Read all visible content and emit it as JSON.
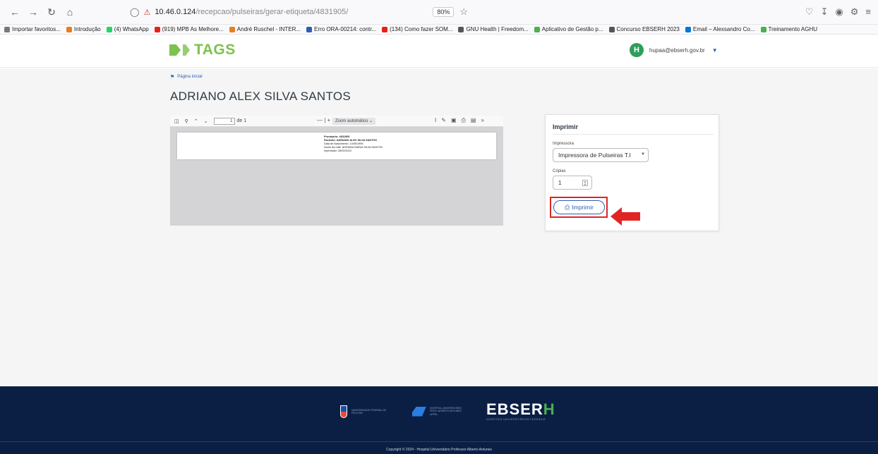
{
  "browser": {
    "url_host": "10.46.0.124",
    "url_path": "/recepcao/pulseiras/gerar-etiqueta/4831905/",
    "zoom": "80%",
    "bookmarks": [
      {
        "label": "Importar favoritos...",
        "color": "#777777"
      },
      {
        "label": "Introdução",
        "color": "#e67e22"
      },
      {
        "label": "(4) WhatsApp",
        "color": "#25d366"
      },
      {
        "label": "(919) MPB As Melhore...",
        "color": "#e62117"
      },
      {
        "label": "André Ruschel - INTER...",
        "color": "#e67e22"
      },
      {
        "label": "Erro ORA-00214: contr...",
        "color": "#2b5fb5"
      },
      {
        "label": "(134) Como fazer SOM...",
        "color": "#e62117"
      },
      {
        "label": "GNU Health | Freedom...",
        "color": "#555555"
      },
      {
        "label": "Aplicativo de Gestão p...",
        "color": "#4caf50"
      },
      {
        "label": "Concurso EBSERH 2023",
        "color": "#555555"
      },
      {
        "label": "Email – Alexsandro Co...",
        "color": "#0078d4"
      },
      {
        "label": "Treinamento AGHU",
        "color": "#4caf50"
      }
    ]
  },
  "header": {
    "logo_text": "TAGS",
    "user_initial": "H",
    "user_email": "hupaa@ebserh.gov.br"
  },
  "breadcrumb": {
    "home_label": "Página inicial"
  },
  "page_title": "ADRIANO ALEX SILVA SANTOS",
  "pdf_viewer": {
    "page_number": "1",
    "page_total": "de 1",
    "zoom_label": "Zoom automático",
    "label_lines": {
      "prontuario": "Prontuário: 4831905",
      "paciente": "Paciente: ADRIANO ALEX SILVA SANTOS",
      "nascimento": "Data de Nascimento: 14/05/1995",
      "mae": "Nome da mãe: ADRIANA MARIA SILVA SANTOS",
      "impressao": "Impressão: 28/02/2024"
    }
  },
  "print_panel": {
    "title": "Imprimir",
    "printer_label": "Impressora",
    "printer_value": "Impressora de Pulseiras T.I",
    "copies_label": "Cópias",
    "copies_value": "1",
    "print_button": "Imprimir"
  },
  "footer": {
    "logo1_text": "UNIVERSIDADE FEDERAL DE PELOTAS",
    "logo2_text": "HOSPITAL UNIVERSITÁRIO PROF. ALBERTO ANTUNES UFPEL",
    "ebserh_main": "EBSER",
    "ebserh_h": "H",
    "ebserh_sub": "HOSPITAIS UNIVERSITÁRIOS FEDERAIS",
    "copyright": "Copyright © 2024 - Hospital Universitário Professor Alberto Antunes"
  },
  "colors": {
    "brand_green": "#7cc24f",
    "link_blue": "#2b5fb5",
    "footer_navy": "#0b1f45",
    "highlight_red": "#e02424"
  }
}
